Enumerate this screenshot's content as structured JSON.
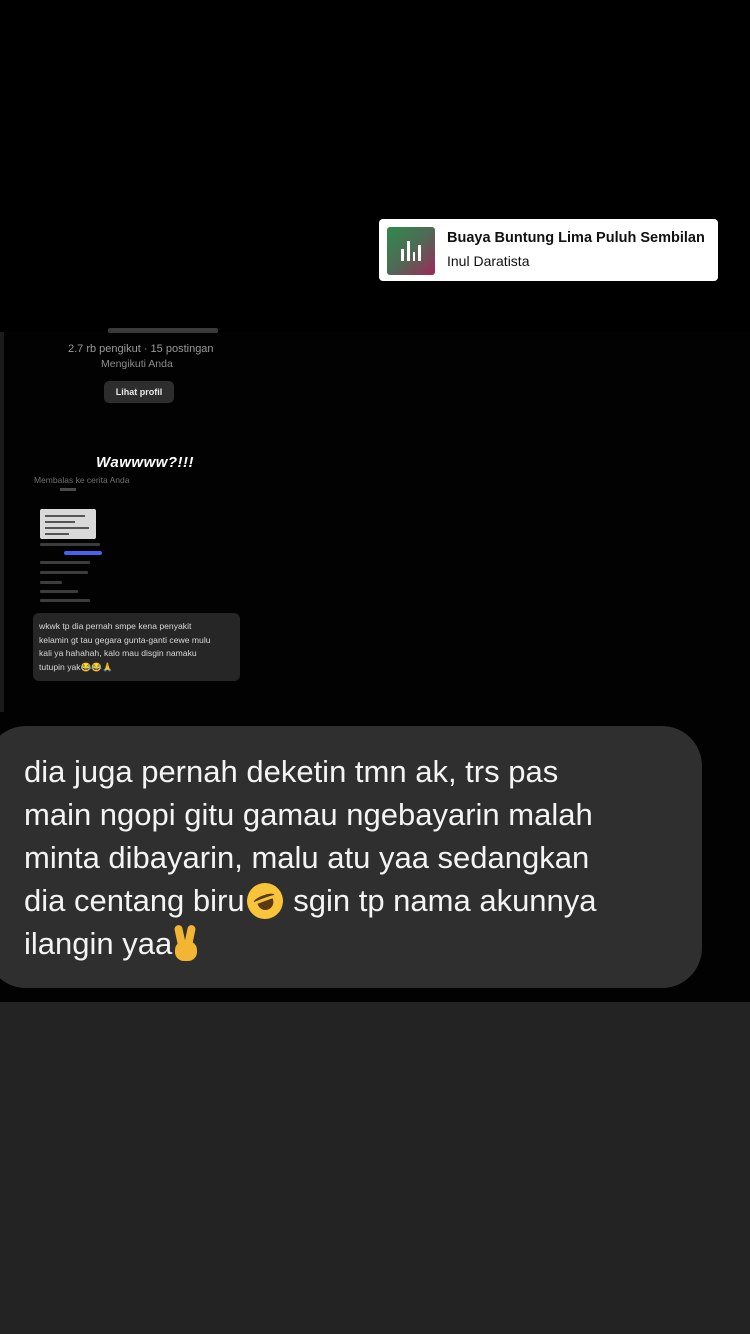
{
  "music_sticker": {
    "song_title": "Buaya Buntung Lima Puluh Sembilan",
    "artist": "Inul Daratista"
  },
  "embedded_screenshot": {
    "profile_stats": "2.7 rb pengikut · 15 postingan",
    "profile_follow_status": "Mengikuti Anda",
    "view_profile_label": "Lihat profil",
    "overlay_text": "Wawwww?!!!",
    "reply_label": "Membalas ke cerita Anda",
    "message": "wkwk tp dia pernah smpe kena penyakit\nkelamin gt tau gegara gunta-ganti cewe mulu\nkali ya hahahah, kalo mau disgin namaku\ntutupin yak😂😂🙏"
  },
  "caption": {
    "line1": "dia juga pernah deketin tmn ak, trs pas\nmain ngopi gitu gamau ngebayarin malah\nminta dibayarin, malu atu yaa sedangkan\ndia centang biru",
    "line2": " sgin tp nama akunnya\nilangin yaa",
    "emoji_1": "rolling-on-the-floor-laughing",
    "emoji_2": "victory-hand"
  },
  "colors": {
    "background": "#000000",
    "caption_bubble": "#2f2f2f",
    "bottom_panel": "#232323",
    "link_blue": "#4b5ff0"
  }
}
